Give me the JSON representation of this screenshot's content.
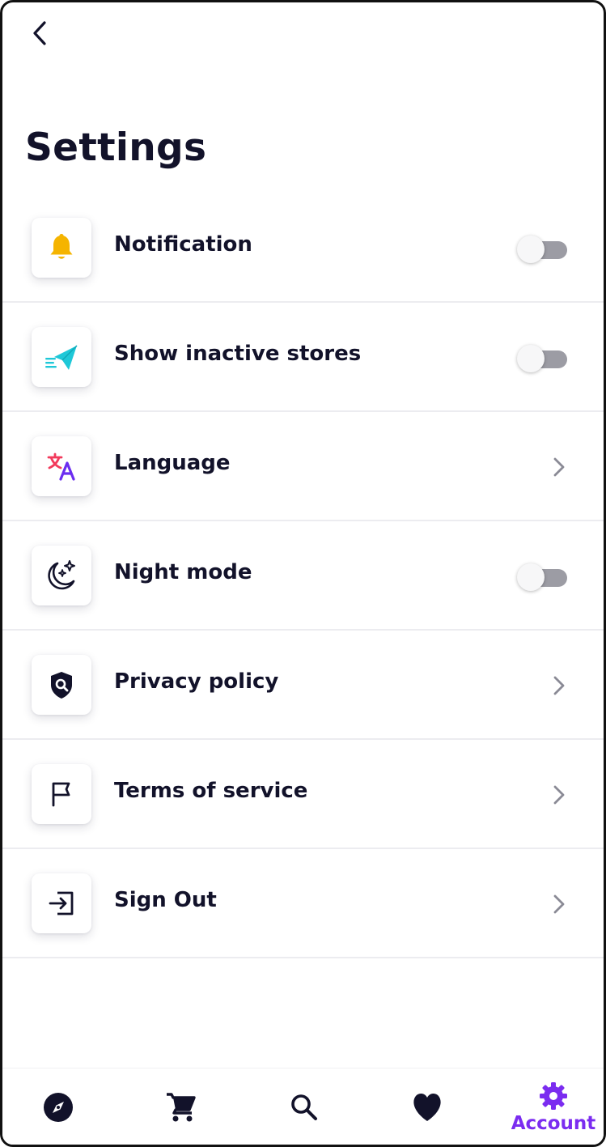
{
  "header": {
    "back_icon": "chevron-left-icon"
  },
  "title": "Settings",
  "settings": [
    {
      "label": "Notification",
      "icon": "bell-icon",
      "control": "toggle",
      "on": false
    },
    {
      "label": "Show inactive stores",
      "icon": "paper-plane-icon",
      "control": "toggle",
      "on": false
    },
    {
      "label": "Language",
      "icon": "translate-icon",
      "control": "chevron"
    },
    {
      "label": "Night mode",
      "icon": "moon-stars-icon",
      "control": "toggle",
      "on": false
    },
    {
      "label": "Privacy policy",
      "icon": "shield-search-icon",
      "control": "chevron"
    },
    {
      "label": "Terms of service",
      "icon": "flag-icon",
      "control": "chevron"
    },
    {
      "label": "Sign Out",
      "icon": "sign-out-icon",
      "control": "chevron"
    }
  ],
  "bottom_nav": {
    "items": [
      {
        "icon": "compass-icon"
      },
      {
        "icon": "cart-icon"
      },
      {
        "icon": "search-icon"
      },
      {
        "icon": "heart-icon"
      },
      {
        "icon": "gear-icon",
        "label": "Account",
        "active": true
      }
    ]
  },
  "colors": {
    "text": "#12122a",
    "accent": "#7b2cf0",
    "bell": "#f5b400",
    "plane": "#1ec8d8",
    "translate_red": "#f2395b",
    "translate_purple": "#6b2df0",
    "toggle_track": "#9c9ca4"
  }
}
